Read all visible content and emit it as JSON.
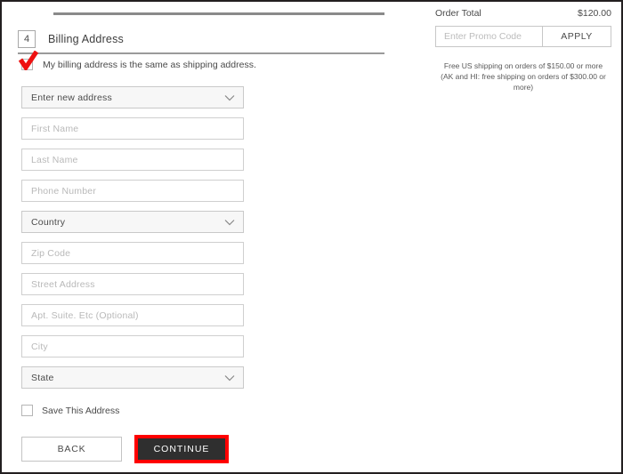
{
  "section": {
    "step_number": "4",
    "title": "Billing Address",
    "same_as_shipping_label": "My billing address is the same as shipping address.",
    "same_as_shipping_checked": true
  },
  "form": {
    "fields": [
      {
        "name": "address-select",
        "type": "select",
        "value": "Enter new address"
      },
      {
        "name": "first-name",
        "type": "text",
        "placeholder": "First Name"
      },
      {
        "name": "last-name",
        "type": "text",
        "placeholder": "Last Name"
      },
      {
        "name": "phone-number",
        "type": "text",
        "placeholder": "Phone Number"
      },
      {
        "name": "country",
        "type": "select",
        "value": "Country"
      },
      {
        "name": "zip-code",
        "type": "text",
        "placeholder": "Zip Code"
      },
      {
        "name": "street-address",
        "type": "text",
        "placeholder": "Street Address"
      },
      {
        "name": "apt-suite",
        "type": "text",
        "placeholder": "Apt. Suite. Etc (Optional)"
      },
      {
        "name": "city",
        "type": "text",
        "placeholder": "City"
      },
      {
        "name": "state",
        "type": "select",
        "value": "State"
      }
    ],
    "save_address_label": "Save This Address",
    "save_address_checked": false
  },
  "buttons": {
    "back_label": "BACK",
    "continue_label": "CONTINUE",
    "continue_highlight_color": "#ff0000",
    "continue_background": "#2f2f2f"
  },
  "summary": {
    "order_total_label": "Order Total",
    "order_total_value": "$120.00",
    "promo_placeholder": "Enter Promo Code",
    "apply_label": "APPLY",
    "shipping_note_line1": "Free US shipping on orders of $150.00 or more",
    "shipping_note_line2": "(AK and HI: free shipping on orders of $300.00 or more)"
  }
}
